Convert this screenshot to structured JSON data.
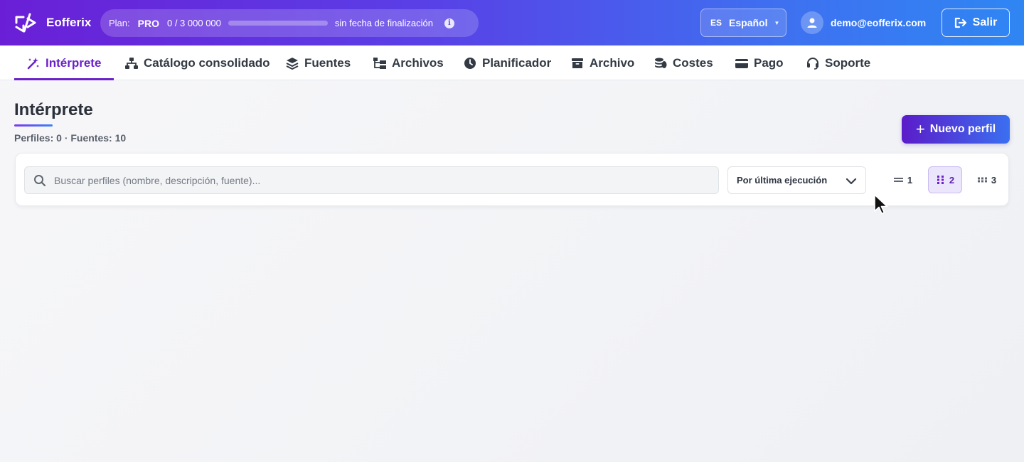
{
  "app": {
    "brand": "Eofferix"
  },
  "plan": {
    "label": "Plan:",
    "name": "PRO",
    "usage": "0 / 3 000 000",
    "usage_fraction": 0,
    "end": "sin fecha de finalización"
  },
  "language": {
    "code": "ES",
    "label": "Español"
  },
  "user": {
    "email": "demo@eofferix.com"
  },
  "logout_label": "Salir",
  "nav": {
    "tabs": [
      {
        "label": "Intérprete",
        "icon": "magic-wand-icon",
        "active": true
      },
      {
        "label": "Catálogo consolidado",
        "icon": "sitemap-icon"
      },
      {
        "label": "Fuentes",
        "icon": "layers-icon"
      },
      {
        "label": "Archivos",
        "icon": "folder-tree-icon"
      },
      {
        "label": "Planificador",
        "icon": "clock-icon"
      },
      {
        "label": "Archivo",
        "icon": "archive-box-icon"
      },
      {
        "label": "Costes",
        "icon": "coins-icon"
      },
      {
        "label": "Pago",
        "icon": "credit-card-icon"
      },
      {
        "label": "Soporte",
        "icon": "headset-icon"
      }
    ]
  },
  "page": {
    "title": "Intérprete",
    "stats": "Perfiles: 0 · Fuentes: 10",
    "new_button": "Nuevo perfil"
  },
  "toolbar": {
    "search_placeholder": "Buscar perfiles (nombre, descripción, fuente)...",
    "sort_label": "Por última ejecución",
    "columns": [
      {
        "label": "1",
        "active": false
      },
      {
        "label": "2",
        "active": true
      },
      {
        "label": "3",
        "active": false
      }
    ]
  },
  "colors": {
    "accent": "#6b21c8",
    "brand_gradient_start": "#6a1fd6",
    "brand_gradient_end": "#2f86f3"
  }
}
